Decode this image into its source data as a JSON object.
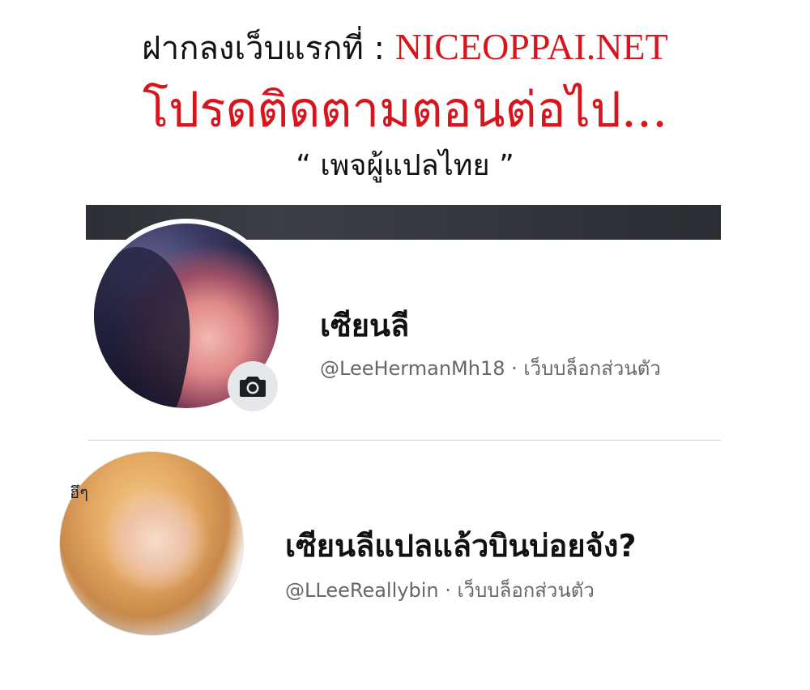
{
  "header": {
    "landing_prefix": "ฝากลงเว็บแรกที่ : ",
    "landing_site": "NICEOPPAI.NET",
    "follow_text": "โปรดติดตามตอนต่อไป...",
    "page_quote": "“ เพจผู้แปลไทย ”"
  },
  "profiles": [
    {
      "name": "เซียนลี",
      "handle": "@LeeHermanMh18",
      "separator": " · ",
      "category": "เว็บบล็อกส่วนตัว",
      "badge_icon": "camera-icon"
    },
    {
      "name": "เซียนลีแปลแล้วบินบ่อยจัง?",
      "handle": "@LLeeReallybin",
      "separator": " · ",
      "category": "เว็บบล็อกส่วนตัว",
      "avatar_mark": "ฮึๆ"
    }
  ],
  "colors": {
    "accent_red": "#d8141c",
    "text": "#111111",
    "meta_text": "#65676b",
    "cover": "#2e3136",
    "badge_bg": "#e6e7ea"
  }
}
